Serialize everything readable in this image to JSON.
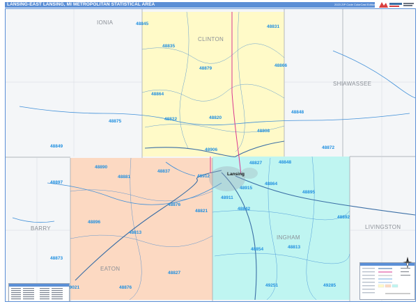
{
  "header": {
    "title": "LANSING-EAST LANSING, MI METROPOLITAN STATISTICAL AREA",
    "edition": "2023 ZIP Code ColorCast Edition",
    "logo_text": "Market Maps"
  },
  "colors": {
    "clinton": "#fffac8",
    "eaton": "#fcd9c2",
    "ingham": "#bff5f1",
    "outside": "#f4f6f8",
    "header": "#5b8fd6",
    "zip_label": "#1f8fe0",
    "water": "#3f8fd8",
    "highway": "#3a6ea5",
    "us_route": "#d9368f",
    "county_line": "#9aa0a8"
  },
  "map": {
    "counties": [
      {
        "name": "IONIA",
        "in_msa": false
      },
      {
        "name": "CLINTON",
        "in_msa": true
      },
      {
        "name": "SHIAWASSEE",
        "in_msa": false
      },
      {
        "name": "BARRY",
        "in_msa": false
      },
      {
        "name": "EATON",
        "in_msa": true
      },
      {
        "name": "INGHAM",
        "in_msa": true
      },
      {
        "name": "LIVINGSTON",
        "in_msa": false
      }
    ],
    "zip_codes": [
      "48845",
      "48831",
      "48835",
      "48866",
      "48875",
      "48879",
      "48864",
      "48848",
      "48822",
      "48820",
      "48808",
      "48849",
      "48872",
      "48906",
      "48827",
      "48890",
      "48837",
      "48848",
      "48897",
      "48881",
      "48912",
      "48915",
      "48864",
      "48895",
      "48876",
      "48821",
      "48911",
      "48842",
      "48892",
      "48896",
      "48813",
      "48813",
      "48854",
      "48873",
      "48827",
      "49251",
      "48876",
      "49285",
      "49021"
    ],
    "cities": [
      "Lansing"
    ]
  },
  "legend": {
    "label": "Legend",
    "rows": 9
  },
  "index": {
    "label": "ZIP Code Index",
    "rows": 6
  },
  "compass": {
    "icon": "compass-rose-icon"
  }
}
